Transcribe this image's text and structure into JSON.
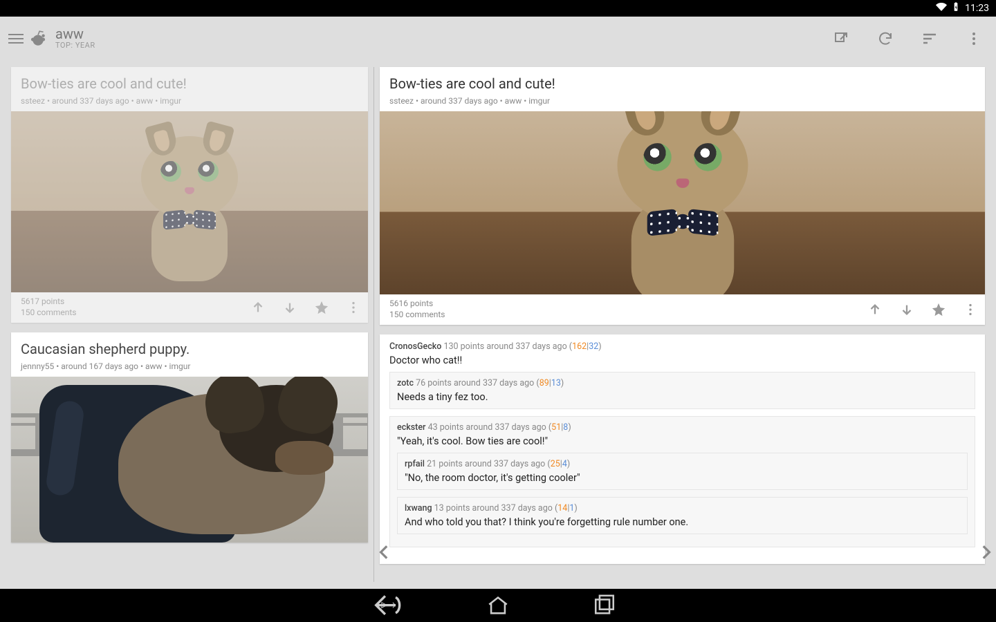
{
  "status": {
    "time": "11:23"
  },
  "toolbar": {
    "title": "aww",
    "subtitle": "TOP: YEAR"
  },
  "list": [
    {
      "title": "Bow-ties are cool and cute!",
      "meta": "ssteez • around 337 days ago • aww • imgur",
      "points": "5617 points",
      "comments": "150 comments",
      "image": "kitten-bowtie"
    },
    {
      "title": "Caucasian shepherd puppy.",
      "meta": "jennny55 • around 167 days ago • aww • imgur",
      "image": "shepherd-puppy"
    }
  ],
  "detail": {
    "title": "Bow-ties are cool and cute!",
    "meta": "ssteez • around 337 days ago • aww • imgur",
    "points": "5616 points",
    "comments": "150 comments",
    "image": "kitten-bowtie"
  },
  "comments": [
    {
      "author": "CronosGecko",
      "info": "130 points around 337 days ago (",
      "up": "162",
      "down": "32",
      "body": "Doctor who cat!!",
      "depth": 0
    },
    {
      "author": "zotc",
      "info": "76 points around 337 days ago (",
      "up": "89",
      "down": "13",
      "body": "Needs a tiny fez too.",
      "depth": 1
    },
    {
      "author": "eckster",
      "info": "43 points around 337 days ago (",
      "up": "51",
      "down": "8",
      "body": "\"Yeah, it's cool. Bow ties are cool!\"",
      "depth": 1
    },
    {
      "author": "rpfail",
      "info": "21 points around 337 days ago (",
      "up": "25",
      "down": "4",
      "body": "\"No, the room doctor, it's getting cooler\"",
      "depth": 2
    },
    {
      "author": "lxwang",
      "info": "13 points around 337 days ago (",
      "up": "14",
      "down": "1",
      "body": "And who told you that? I think you're forgetting rule number one.",
      "depth": 2
    }
  ]
}
